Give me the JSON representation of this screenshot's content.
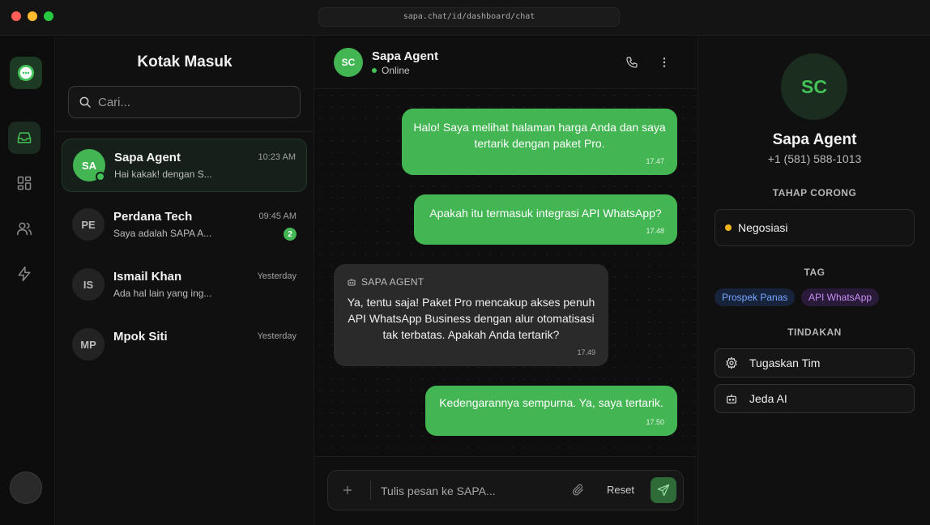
{
  "browser": {
    "url": "sapa.chat/id/dashboard/chat"
  },
  "inbox": {
    "title": "Kotak Masuk",
    "search_placeholder": "Cari...",
    "conversations": [
      {
        "initials": "SA",
        "name": "Sapa Agent",
        "preview": "Hai kakak! dengan S...",
        "time": "10:23 AM",
        "unread": ""
      },
      {
        "initials": "PE",
        "name": "Perdana Tech",
        "preview": "Saya adalah SAPA A...",
        "time": "09:45 AM",
        "unread": "2"
      },
      {
        "initials": "IS",
        "name": "Ismail Khan",
        "preview": "Ada hal lain yang ing...",
        "time": "Yesterday",
        "unread": ""
      },
      {
        "initials": "MP",
        "name": "Mpok Siti",
        "preview": "",
        "time": "Yesterday",
        "unread": ""
      }
    ]
  },
  "chat": {
    "contact_initials": "SC",
    "contact_name": "Sapa Agent",
    "status": "Online",
    "messages": [
      {
        "direction": "out",
        "text": "Halo! Saya melihat halaman harga Anda dan saya tertarik dengan paket Pro.",
        "time": "17.47"
      },
      {
        "direction": "out",
        "text": "Apakah itu termasuk integrasi API WhatsApp?",
        "time": "17.48"
      },
      {
        "direction": "in",
        "sender": "SAPA AGENT",
        "text": "Ya, tentu saja! Paket Pro mencakup akses penuh API WhatsApp Business dengan alur otomatisasi tak terbatas. Apakah Anda tertarik?",
        "time": "17.49"
      },
      {
        "direction": "out",
        "text": "Kedengarannya sempurna. Ya, saya tertarik.",
        "time": "17.50"
      }
    ],
    "composer_placeholder": "Tulis pesan ke SAPA...",
    "reset_label": "Reset"
  },
  "detail": {
    "initials": "SC",
    "name": "Sapa Agent",
    "phone": "+1 (581) 588-1013",
    "stage_title": "TAHAP CORONG",
    "stage_value": "Negosiasi",
    "tag_title": "TAG",
    "tags": [
      "Prospek Panas",
      "API WhatsApp"
    ],
    "actions_title": "TINDAKAN",
    "actions": [
      "Tugaskan Tim",
      "Jeda AI"
    ]
  },
  "colors": {
    "accent": "#43b653",
    "stage_dot": "#f3b51c"
  },
  "icons": [
    "chat-bubble-icon",
    "inbox-icon",
    "grid-icon",
    "users-icon",
    "bolt-icon",
    "search-icon",
    "phone-icon",
    "more-vertical-icon",
    "bot-icon",
    "plus-icon",
    "paperclip-icon",
    "send-icon",
    "gear-icon"
  ]
}
